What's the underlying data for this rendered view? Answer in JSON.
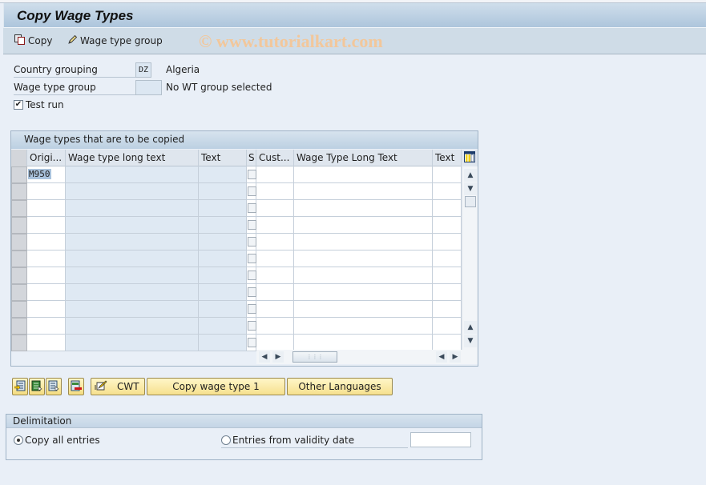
{
  "window": {
    "title": "Copy Wage Types",
    "watermark": "© www.tutorialkart.com"
  },
  "toolbar": {
    "copy_label": "Copy",
    "wage_type_group_label": "Wage type group"
  },
  "form": {
    "country_grouping_label": "Country grouping",
    "country_grouping_value": "DZ",
    "country_grouping_text": "Algeria",
    "wage_type_group_label": "Wage type group",
    "wage_type_group_value": "",
    "wage_type_group_text": "No WT group selected",
    "test_run_label": "Test run",
    "test_run_checked": true
  },
  "table": {
    "title": "Wage types that are to be copied",
    "columns": [
      "Origi...",
      "Wage type long text",
      "Text",
      "S",
      "Cust...",
      "Wage Type Long Text",
      "Text"
    ],
    "rows": [
      {
        "original": "M950",
        "long_text": "",
        "text": "",
        "s": false,
        "custom": "",
        "custom_long_text": "",
        "custom_text": ""
      },
      {
        "original": "",
        "long_text": "",
        "text": "",
        "s": false,
        "custom": "",
        "custom_long_text": "",
        "custom_text": ""
      },
      {
        "original": "",
        "long_text": "",
        "text": "",
        "s": false,
        "custom": "",
        "custom_long_text": "",
        "custom_text": ""
      },
      {
        "original": "",
        "long_text": "",
        "text": "",
        "s": false,
        "custom": "",
        "custom_long_text": "",
        "custom_text": ""
      },
      {
        "original": "",
        "long_text": "",
        "text": "",
        "s": false,
        "custom": "",
        "custom_long_text": "",
        "custom_text": ""
      },
      {
        "original": "",
        "long_text": "",
        "text": "",
        "s": false,
        "custom": "",
        "custom_long_text": "",
        "custom_text": ""
      },
      {
        "original": "",
        "long_text": "",
        "text": "",
        "s": false,
        "custom": "",
        "custom_long_text": "",
        "custom_text": ""
      },
      {
        "original": "",
        "long_text": "",
        "text": "",
        "s": false,
        "custom": "",
        "custom_long_text": "",
        "custom_text": ""
      },
      {
        "original": "",
        "long_text": "",
        "text": "",
        "s": false,
        "custom": "",
        "custom_long_text": "",
        "custom_text": ""
      },
      {
        "original": "",
        "long_text": "",
        "text": "",
        "s": false,
        "custom": "",
        "custom_long_text": "",
        "custom_text": ""
      },
      {
        "original": "",
        "long_text": "",
        "text": "",
        "s": false,
        "custom": "",
        "custom_long_text": "",
        "custom_text": ""
      }
    ]
  },
  "actions": {
    "icon_buttons": [
      "insert-row-icon",
      "select-all-icon",
      "deselect-all-icon",
      "delete-row-icon"
    ],
    "cwt_label": "CWT",
    "copy_wage_type_label": "Copy wage type 1",
    "other_languages_label": "Other Languages"
  },
  "delimitation": {
    "title": "Delimitation",
    "copy_all_label": "Copy all entries",
    "copy_all_selected": true,
    "from_date_label": "Entries from validity date",
    "from_date_selected": false,
    "from_date_value": ""
  }
}
